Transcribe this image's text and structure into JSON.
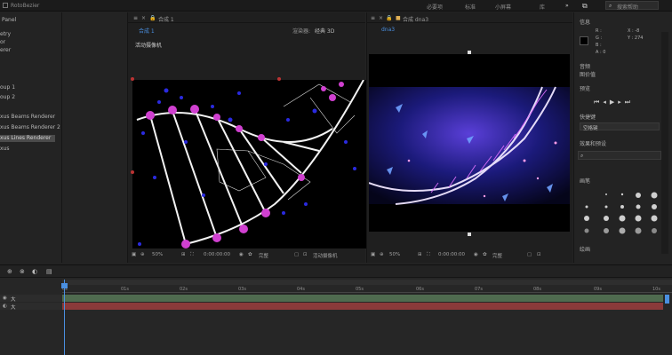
{
  "topbar": {
    "tool_label": "RotoBezier",
    "workspaces": [
      "必要项",
      "标准",
      "小屏幕",
      "库"
    ],
    "search_placeholder": "搜索帮助"
  },
  "left_panel": {
    "title": "Panel",
    "items": [
      "etry",
      "or",
      "erer",
      "oup 1",
      "oup 2",
      "xus Beams Renderer",
      "xus Beams Renderer 2",
      "xus Lines Renderer",
      "xus"
    ]
  },
  "viewer1": {
    "tab_title": "合成 1",
    "tab_label": "合成 1",
    "renderer_label": "渲染器:",
    "renderer_value": "经典 3D",
    "camera_label": "活动摄像机",
    "zoom": "50%",
    "timecode": "0:00:00:00",
    "quality": "完整",
    "view": "活动摄像机"
  },
  "viewer2": {
    "tab_title": "合成 dna3",
    "tab_label": "dna3",
    "zoom": "50%",
    "timecode": "0:00:00:00",
    "quality": "完整"
  },
  "right_panel": {
    "info_title": "信息",
    "rgba": [
      "R :",
      "G :",
      "B :",
      "A : 0"
    ],
    "xy": [
      "X : -8",
      "Y : 274"
    ],
    "audio_title": "音频",
    "fx_label": "图价值",
    "preview_title": "预览",
    "shortcut_title": "快捷键",
    "shortcut_value": "空格键",
    "effects_title": "效果和预设",
    "brush_title": "画笔",
    "paint_title": "绘画"
  },
  "timeline": {
    "ticks": [
      "0s",
      "01s",
      "02s",
      "03s",
      "04s",
      "05s",
      "06s",
      "07s",
      "08s",
      "09s",
      "10s"
    ],
    "layer_name": "大",
    "layer_switch": "大"
  },
  "colors": {
    "accent": "#4a8fe0",
    "track_green": "#4f6b4f",
    "track_red": "#8a3a3a"
  }
}
